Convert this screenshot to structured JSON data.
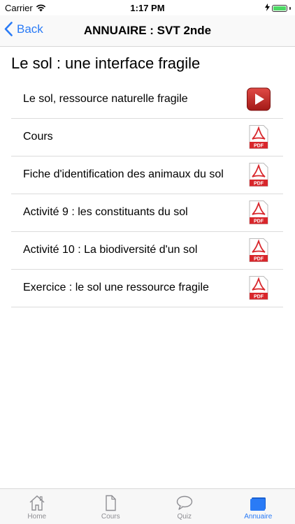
{
  "status_bar": {
    "carrier": "Carrier",
    "time": "1:17 PM"
  },
  "nav": {
    "back_label": "Back",
    "title": "ANNUAIRE : SVT 2nde"
  },
  "section": {
    "title": "Le sol : une interface fragile"
  },
  "items": [
    {
      "label": "Le sol, ressource naturelle fragile",
      "icon": "video-play-icon"
    },
    {
      "label": "Cours",
      "icon": "pdf-icon"
    },
    {
      "label": "Fiche d'identification des animaux du sol",
      "icon": "pdf-icon"
    },
    {
      "label": "Activité 9 : les constituants du sol",
      "icon": "pdf-icon"
    },
    {
      "label": "Activité 10 : La biodiversité d'un sol",
      "icon": "pdf-icon"
    },
    {
      "label": "Exercice : le sol une ressource fragile",
      "icon": "pdf-icon"
    }
  ],
  "pdf_badge": "PDF",
  "tabs": [
    {
      "label": "Home",
      "icon": "home-icon",
      "active": false
    },
    {
      "label": "Cours",
      "icon": "document-icon",
      "active": false
    },
    {
      "label": "Quiz",
      "icon": "chat-bubble-icon",
      "active": false
    },
    {
      "label": "Annuaire",
      "icon": "folder-icon",
      "active": true
    }
  ],
  "colors": {
    "accent": "#2a7bf6",
    "battery": "#4cd964",
    "pdf_red": "#d8262b"
  }
}
